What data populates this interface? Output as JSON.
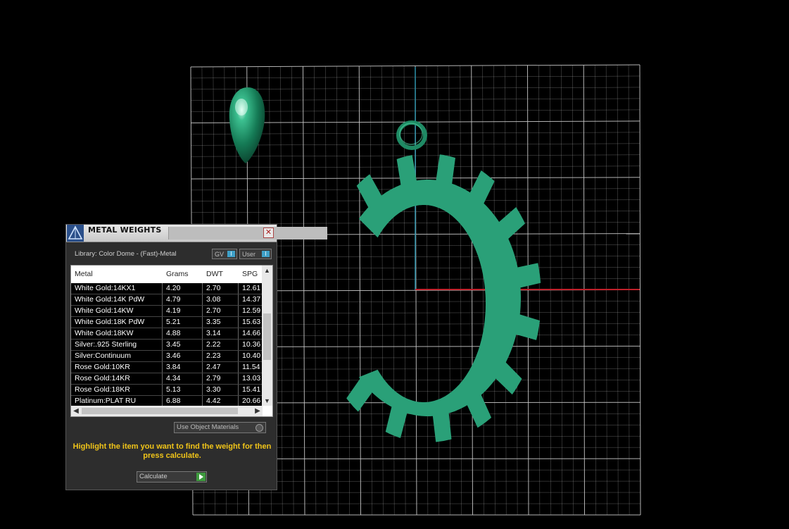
{
  "panel": {
    "title": "METAL WEIGHTS",
    "close_glyph": "✕",
    "library_label": "Library: Color Dome - (Fast)-Metal",
    "gv_label": "GV",
    "user_label": "User",
    "toggle_glyph": "I",
    "columns": [
      "Metal",
      "Grams",
      "DWT",
      "SPG"
    ],
    "rows": [
      [
        "White Gold:14KX1",
        "4.20",
        "2.70",
        "12.61"
      ],
      [
        "White Gold:14K PdW",
        "4.79",
        "3.08",
        "14.37"
      ],
      [
        "White Gold:14KW",
        "4.19",
        "2.70",
        "12.59"
      ],
      [
        "White Gold:18K PdW",
        "5.21",
        "3.35",
        "15.63"
      ],
      [
        "White Gold:18KW",
        "4.88",
        "3.14",
        "14.66"
      ],
      [
        "Silver:.925 Sterling",
        "3.45",
        "2.22",
        "10.36"
      ],
      [
        "Silver:Continuum",
        "3.46",
        "2.23",
        "10.40"
      ],
      [
        "Rose Gold:10KR",
        "3.84",
        "2.47",
        "11.54"
      ],
      [
        "Rose Gold:14KR",
        "4.34",
        "2.79",
        "13.03"
      ],
      [
        "Rose Gold:18KR",
        "5.13",
        "3.30",
        "15.41"
      ],
      [
        "Platinum:PLAT RU",
        "6.88",
        "4.42",
        "20.66"
      ]
    ],
    "use_object_materials": "Use Object Materials",
    "hint": "Highlight the item you want to find the weight for then press calculate.",
    "calculate_label": "Calculate"
  },
  "scene": {
    "model_color": "#2aa078",
    "grid_color": "#c8c8c8",
    "x_axis_color": "#c0202a",
    "y_axis_color": "#2a8fa8",
    "objects": [
      "teardrop-gem",
      "gear-letter-c-pendant",
      "bail-ring"
    ]
  }
}
